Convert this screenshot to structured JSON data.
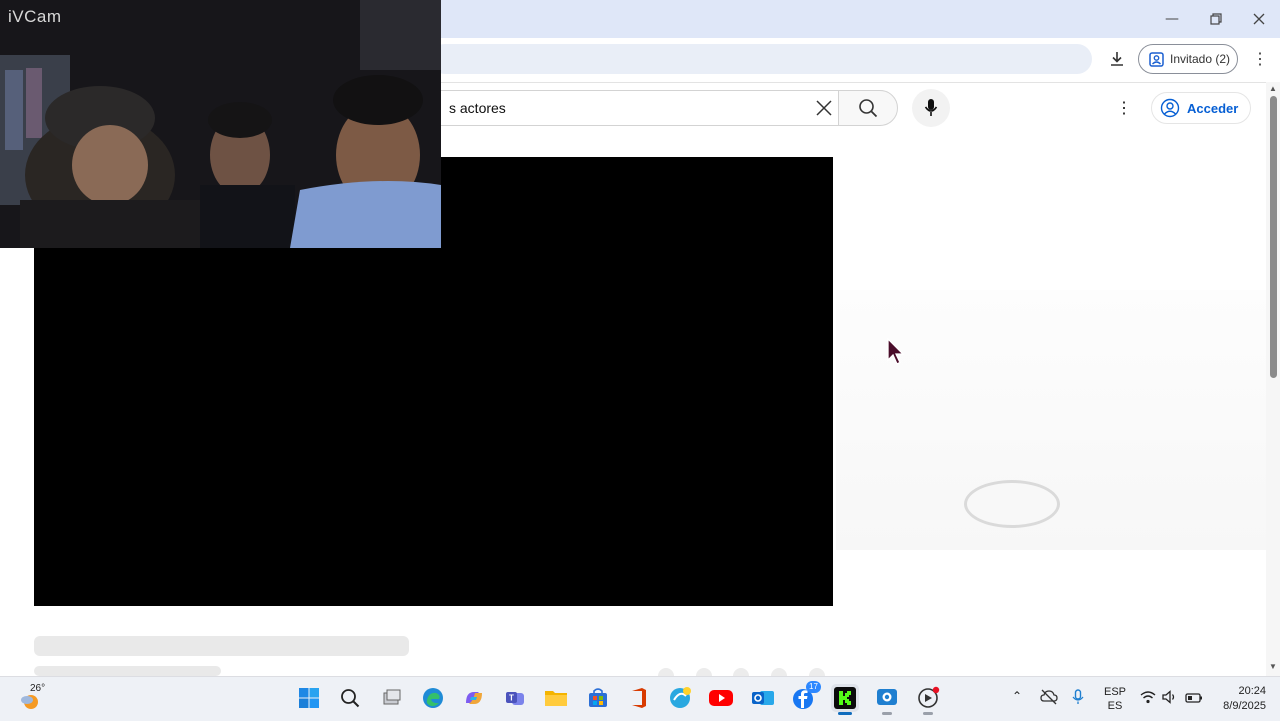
{
  "webcam": {
    "label": "iVCam"
  },
  "browser": {
    "profile_label": "Invitado (2)",
    "window_controls": [
      "minimize-icon",
      "restore-icon",
      "close-icon"
    ]
  },
  "youtube": {
    "search_value": "s actores",
    "signin_label": "Acceder"
  },
  "taskbar": {
    "weather_temp": "26°",
    "apps": [
      "start",
      "search",
      "task-view",
      "edge",
      "copilot",
      "teams",
      "file-explorer",
      "store",
      "office",
      "browser-alt",
      "youtube",
      "outlook",
      "facebook",
      "kick",
      "camera",
      "media"
    ],
    "facebook_badge": "17",
    "language_line1": "ESP",
    "language_line2": "ES",
    "time": "20:24",
    "date": "8/9/2025"
  },
  "colors": {
    "accent": "#065fd4",
    "titlebar": "#dfe7f8",
    "kick_green": "#53fc18"
  }
}
